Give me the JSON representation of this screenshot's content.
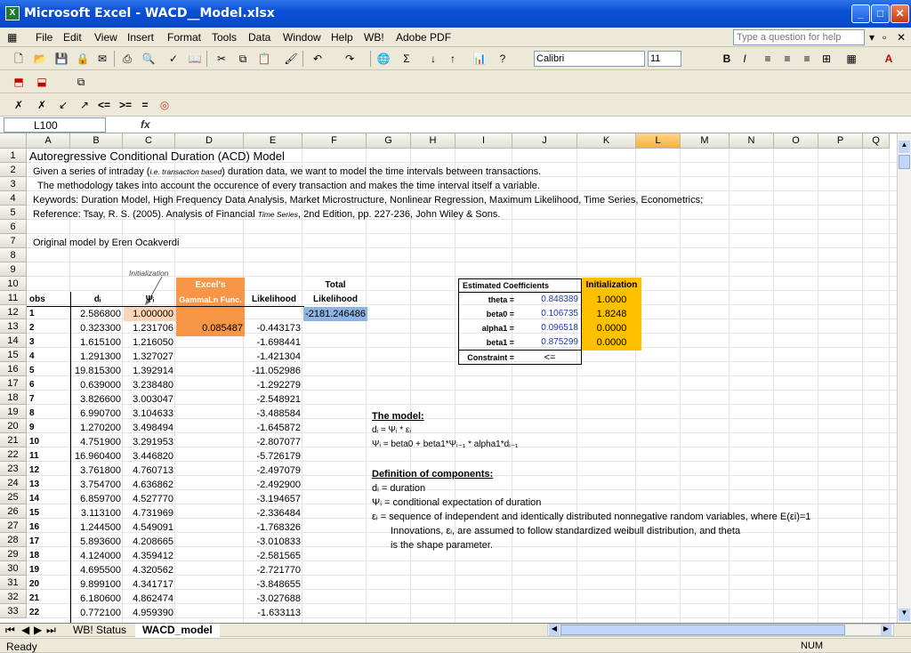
{
  "window": {
    "title": "Microsoft Excel - WACD__Model.xlsx",
    "app_icon_letter": "X"
  },
  "menu": [
    "File",
    "Edit",
    "View",
    "Insert",
    "Format",
    "Tools",
    "Data",
    "Window",
    "Help",
    "WB!",
    "Adobe PDF"
  ],
  "help_placeholder": "Type a question for help",
  "font": {
    "name": "Calibri",
    "size": "11"
  },
  "toolbar3_symbols": [
    "<=",
    ">=",
    "="
  ],
  "namebox": "L100",
  "fx_label": "fx",
  "columns": [
    "A",
    "B",
    "C",
    "D",
    "E",
    "F",
    "G",
    "H",
    "I",
    "J",
    "K",
    "L",
    "M",
    "N",
    "O",
    "P",
    "Q"
  ],
  "selected_column": "L",
  "rows": [
    "1",
    "2",
    "3",
    "4",
    "5",
    "6",
    "7",
    "8",
    "9",
    "10",
    "11",
    "12",
    "13",
    "14",
    "15",
    "16",
    "17",
    "18",
    "19",
    "20",
    "21",
    "22",
    "23",
    "24",
    "25",
    "26",
    "27",
    "28",
    "29",
    "30",
    "31",
    "32",
    "33"
  ],
  "header_text": {
    "r1": "Autoregressive Conditional Duration (ACD) Model",
    "r2a": "Given a series of intraday (",
    "r2b": "i.e. transaction based",
    "r2c": ") duration data, we want to model the time intervals between transactions.",
    "r3": "The methodology takes into account the occurence of every transaction and makes the time interval itself a variable.",
    "r4": "Keywords: Duration Model, High Frequency Data Analysis, Market Microstructure, Nonlinear Regression, Maximum Likelihood, Time Series, Econometrics;",
    "r5a": "Reference: Tsay, R. S. (2005). Analysis of Financial",
    "r5b": "Time Series",
    "r5c": ", 2nd Edition, pp. 227-236, John Wiley & Sons.",
    "r7": "Original model by Eren Ocakverdi",
    "initialization_note": "Initialization"
  },
  "table_headers": {
    "obs": "obs",
    "d": "dᵢ",
    "psi": "Ψᵢ",
    "excel1": "Excel's",
    "excel2": "GammaLn Func.",
    "likelihood": "Likelihood",
    "total1": "Total",
    "total2": "Likelihood"
  },
  "gammaln_value": "0.085487",
  "total_likelihood": "-2181.246486",
  "data_rows": [
    {
      "obs": "1",
      "d": "2.586800",
      "psi": "1.000000",
      "lik": ""
    },
    {
      "obs": "2",
      "d": "0.323300",
      "psi": "1.231706",
      "lik": "-0.443173"
    },
    {
      "obs": "3",
      "d": "1.615100",
      "psi": "1.216050",
      "lik": "-1.698441"
    },
    {
      "obs": "4",
      "d": "1.291300",
      "psi": "1.327027",
      "lik": "-1.421304"
    },
    {
      "obs": "5",
      "d": "19.815300",
      "psi": "1.392914",
      "lik": "-11.052986"
    },
    {
      "obs": "6",
      "d": "0.639000",
      "psi": "3.238480",
      "lik": "-1.292279"
    },
    {
      "obs": "7",
      "d": "3.826600",
      "psi": "3.003047",
      "lik": "-2.548921"
    },
    {
      "obs": "8",
      "d": "6.990700",
      "psi": "3.104633",
      "lik": "-3.488584"
    },
    {
      "obs": "9",
      "d": "1.270200",
      "psi": "3.498494",
      "lik": "-1.645872"
    },
    {
      "obs": "10",
      "d": "4.751900",
      "psi": "3.291953",
      "lik": "-2.807077"
    },
    {
      "obs": "11",
      "d": "16.960400",
      "psi": "3.446820",
      "lik": "-5.726179"
    },
    {
      "obs": "12",
      "d": "3.761800",
      "psi": "4.760713",
      "lik": "-2.497079"
    },
    {
      "obs": "13",
      "d": "3.754700",
      "psi": "4.636862",
      "lik": "-2.492900"
    },
    {
      "obs": "14",
      "d": "6.859700",
      "psi": "4.527770",
      "lik": "-3.194657"
    },
    {
      "obs": "15",
      "d": "3.113100",
      "psi": "4.731969",
      "lik": "-2.336484"
    },
    {
      "obs": "16",
      "d": "1.244500",
      "psi": "4.549091",
      "lik": "-1.768326"
    },
    {
      "obs": "17",
      "d": "5.893600",
      "psi": "4.208665",
      "lik": "-3.010833"
    },
    {
      "obs": "18",
      "d": "4.124000",
      "psi": "4.359412",
      "lik": "-2.581565"
    },
    {
      "obs": "19",
      "d": "4.695500",
      "psi": "4.320562",
      "lik": "-2.721770"
    },
    {
      "obs": "20",
      "d": "9.899100",
      "psi": "4.341717",
      "lik": "-3.848655"
    },
    {
      "obs": "21",
      "d": "6.180600",
      "psi": "4.862474",
      "lik": "-3.027688"
    },
    {
      "obs": "22",
      "d": "0.772100",
      "psi": "4.959390",
      "lik": "-1.633113"
    }
  ],
  "coef": {
    "title": "Estimated Coefficients",
    "init_title": "Initialization",
    "items": [
      {
        "name": "theta =",
        "value": "0.848389",
        "init": "1.0000"
      },
      {
        "name": "beta0 =",
        "value": "0.106735",
        "init": "1.8248"
      },
      {
        "name": "alpha1 =",
        "value": "0.096518",
        "init": "0.0000"
      },
      {
        "name": "beta1 =",
        "value": "0.875299",
        "init": "0.0000"
      }
    ],
    "constraint_label": "Constraint =",
    "constraint_value": "<="
  },
  "model": {
    "title": "The model:",
    "eq1": "dᵢ = Ψᵢ * εᵢ",
    "eq2": "Ψᵢ = beta0 + beta1*Ψᵢ₋₁ * alpha1*dᵢ₋₁",
    "def_title": "Definition of components:",
    "def1": "dᵢ = duration",
    "def2": "Ψᵢ = conditional expectation of duration",
    "def3": "εᵢ = sequence of independent and identically distributed nonnegative random variables, where E(εi)=1",
    "def4": "Innovations, εᵢ, are assumed to follow standardized weibull distribution, and theta",
    "def5": "is the shape parameter."
  },
  "sheets": [
    "WB! Status",
    "WACD_model"
  ],
  "status": {
    "left": "Ready",
    "num": "NUM"
  }
}
